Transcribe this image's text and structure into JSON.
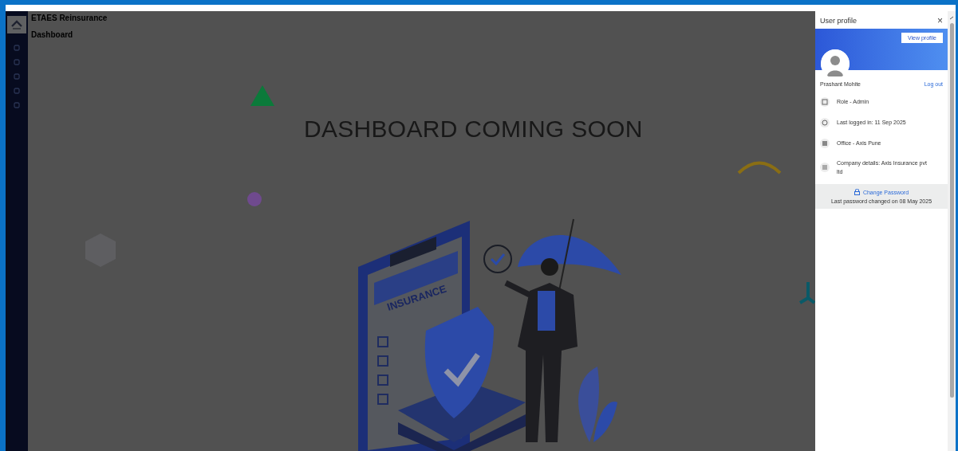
{
  "app": {
    "title": "ETAES Reinsurance",
    "breadcrumb": "Dashboard"
  },
  "main": {
    "heading": "DASHBOARD COMING SOON",
    "illustration_label": "INSURANCE"
  },
  "profile_panel": {
    "title": "User profile",
    "close": "×",
    "view_profile_button": "View profile",
    "name": "Prashant Mohite",
    "logout": "Log out",
    "details": [
      {
        "kind": "role",
        "text": "Role - Admin"
      },
      {
        "kind": "login",
        "text": "Last logged in: 11 Sep 2025"
      },
      {
        "kind": "office",
        "text": "Office - Axis Pune"
      },
      {
        "kind": "company",
        "text": "Company details: Axis Insurance pvt ltd"
      }
    ],
    "change_password": "Change Password",
    "password_note": "Last password changed on 08 May 2025"
  }
}
